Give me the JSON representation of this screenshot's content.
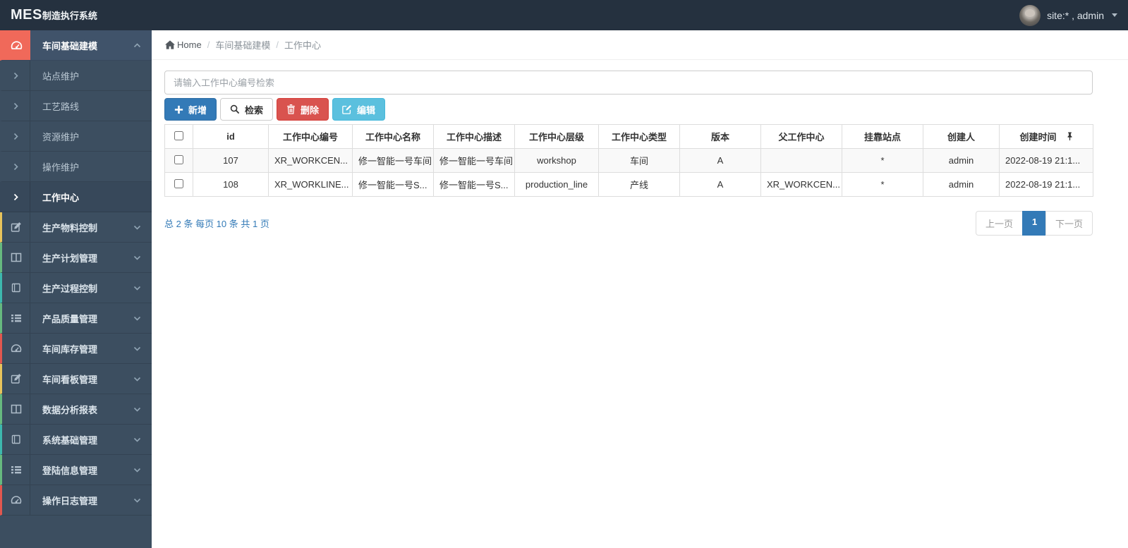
{
  "colors": {
    "navbar_bg": "#25313f",
    "sidebar_bg": "#3c4e60",
    "active_accent": "#f0695a",
    "primary_blue": "#337ab7",
    "danger_red": "#d9534f",
    "info_cyan": "#5bc0de",
    "accent_yellow": "#e8c35b",
    "accent_green": "#66b97f",
    "accent_teal": "#3db8ae",
    "accent_red": "#e2574f"
  },
  "navbar": {
    "logo_primary": "MES",
    "logo_secondary": "制造执行系统",
    "user_label": "site:* , admin"
  },
  "breadcrumb": {
    "home": "Home",
    "level1": "车间基础建模",
    "level2": "工作中心"
  },
  "sidebar": {
    "items": [
      {
        "label": "车间基础建模",
        "icon": "dashboard-icon",
        "expanded": true,
        "active": true
      },
      {
        "label": "生产物料控制",
        "icon": "edit-icon"
      },
      {
        "label": "生产计划管理",
        "icon": "columns-icon"
      },
      {
        "label": "生产过程控制",
        "icon": "book-icon"
      },
      {
        "label": "产品质量管理",
        "icon": "list-icon"
      },
      {
        "label": "车间库存管理",
        "icon": "dashboard-icon"
      },
      {
        "label": "车间看板管理",
        "icon": "edit-icon"
      },
      {
        "label": "数据分析报表",
        "icon": "columns-icon"
      },
      {
        "label": "系统基础管理",
        "icon": "book-icon"
      },
      {
        "label": "登陆信息管理",
        "icon": "list-icon"
      },
      {
        "label": "操作日志管理",
        "icon": "dashboard-icon"
      }
    ],
    "subitems": [
      {
        "label": "站点维护"
      },
      {
        "label": "工艺路线"
      },
      {
        "label": "资源维护"
      },
      {
        "label": "操作维护"
      },
      {
        "label": "工作中心",
        "active": true
      }
    ]
  },
  "search": {
    "placeholder": "请输入工作中心编号检索"
  },
  "toolbar": {
    "add": "新增",
    "query": "检索",
    "delete": "删除",
    "edit": "编辑"
  },
  "table": {
    "columns": [
      "id",
      "工作中心编号",
      "工作中心名称",
      "工作中心描述",
      "工作中心层级",
      "工作中心类型",
      "版本",
      "父工作中心",
      "挂靠站点",
      "创建人",
      "创建时间"
    ],
    "rows": [
      {
        "cells": [
          "107",
          "XR_WORKCEN...",
          "修一智能一号车间",
          "修一智能一号车间",
          "workshop",
          "车间",
          "A",
          "",
          "*",
          "admin",
          "2022-08-19 21:1..."
        ]
      },
      {
        "cells": [
          "108",
          "XR_WORKLINE...",
          "修一智能一号S...",
          "修一智能一号S...",
          "production_line",
          "产线",
          "A",
          "XR_WORKCEN...",
          "*",
          "admin",
          "2022-08-19 21:1..."
        ]
      }
    ]
  },
  "pagination": {
    "summary": "总 2 条 每页 10 条 共 1 页",
    "prev": "上一页",
    "current": "1",
    "next": "下一页"
  }
}
